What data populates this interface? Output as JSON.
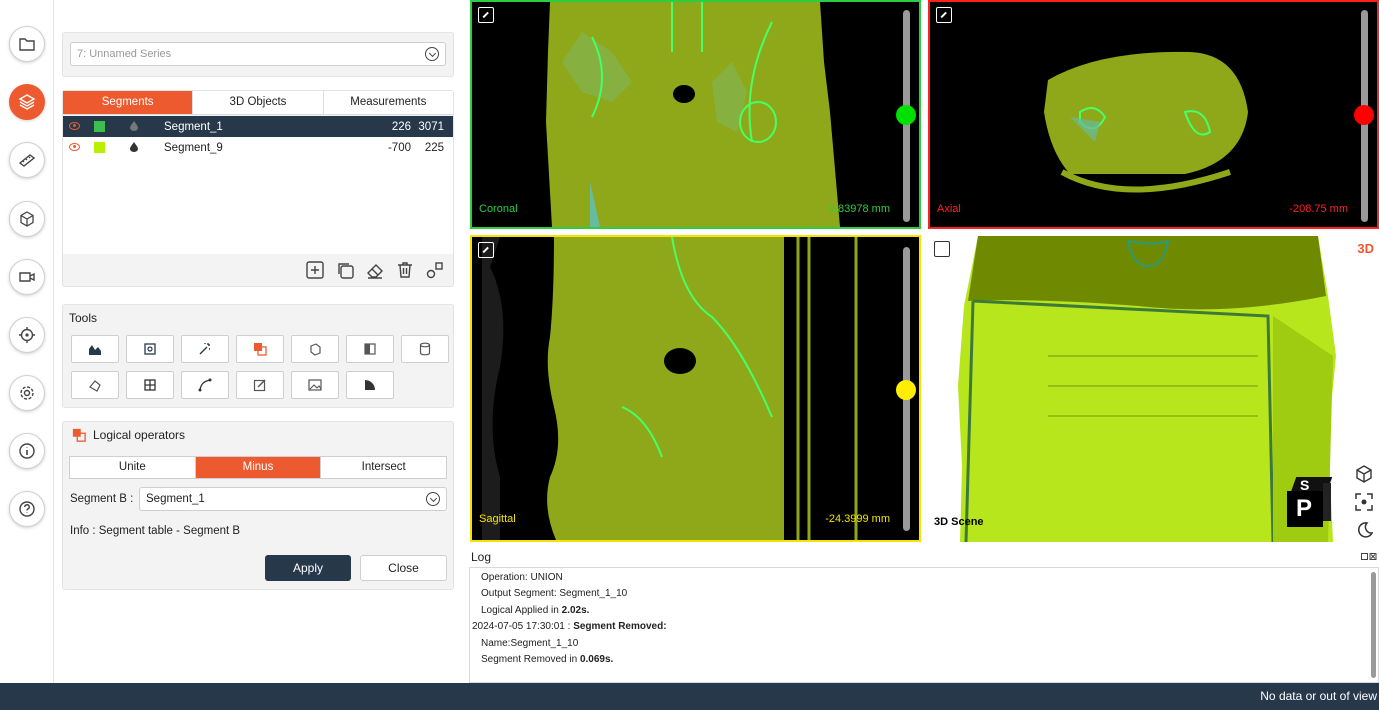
{
  "series_select": {
    "value": "7: Unnamed Series"
  },
  "tabs": [
    {
      "label": "Segments"
    },
    {
      "label": "3D Objects"
    },
    {
      "label": "Measurements"
    }
  ],
  "segments": [
    {
      "name": "Segment_1",
      "min": "226",
      "max": "3071",
      "color": "#3cbf4f"
    },
    {
      "name": "Segment_9",
      "min": "-700",
      "max": "225",
      "color": "#b7f000"
    }
  ],
  "tools": {
    "title": "Tools"
  },
  "logical": {
    "title": "Logical operators",
    "ops": [
      {
        "label": "Unite"
      },
      {
        "label": "Minus"
      },
      {
        "label": "Intersect"
      }
    ],
    "segment_b_label": "Segment B :",
    "segment_b_value": "Segment_1",
    "info": "Info : Segment table - Segment B",
    "apply": "Apply",
    "close": "Close"
  },
  "viewports": {
    "coronal": {
      "label": "Coronal",
      "readout": "0.83978 mm",
      "color": "#2ecc40"
    },
    "axial": {
      "label": "Axial",
      "readout": "-208.75 mm",
      "color": "#ff2020"
    },
    "sagittal": {
      "label": "Sagittal",
      "readout": "-24.3999 mm",
      "color": "#f5e400"
    },
    "scene": {
      "label": "3D Scene",
      "corner": "3D",
      "cube_top": "S",
      "cube_front": "P"
    }
  },
  "log": {
    "title": "Log",
    "lines": [
      {
        "text": "Operation: UNION",
        "bold": ""
      },
      {
        "text": "Output Segment: Segment_1_10",
        "bold": ""
      },
      {
        "text": "Logical Applied in ",
        "bold": "2.02s."
      },
      {
        "text": "2024-07-05 17:30:01 : ",
        "bold": "Segment Removed:"
      },
      {
        "text": "Name:Segment_1_10",
        "bold": ""
      },
      {
        "text": "Segment Removed in ",
        "bold": "0.069s."
      }
    ]
  },
  "status": {
    "text": "No data or out of view"
  },
  "colors": {
    "accent": "#ee5a2f",
    "navy": "#27384b",
    "segment_fill": "#9ec41a"
  }
}
